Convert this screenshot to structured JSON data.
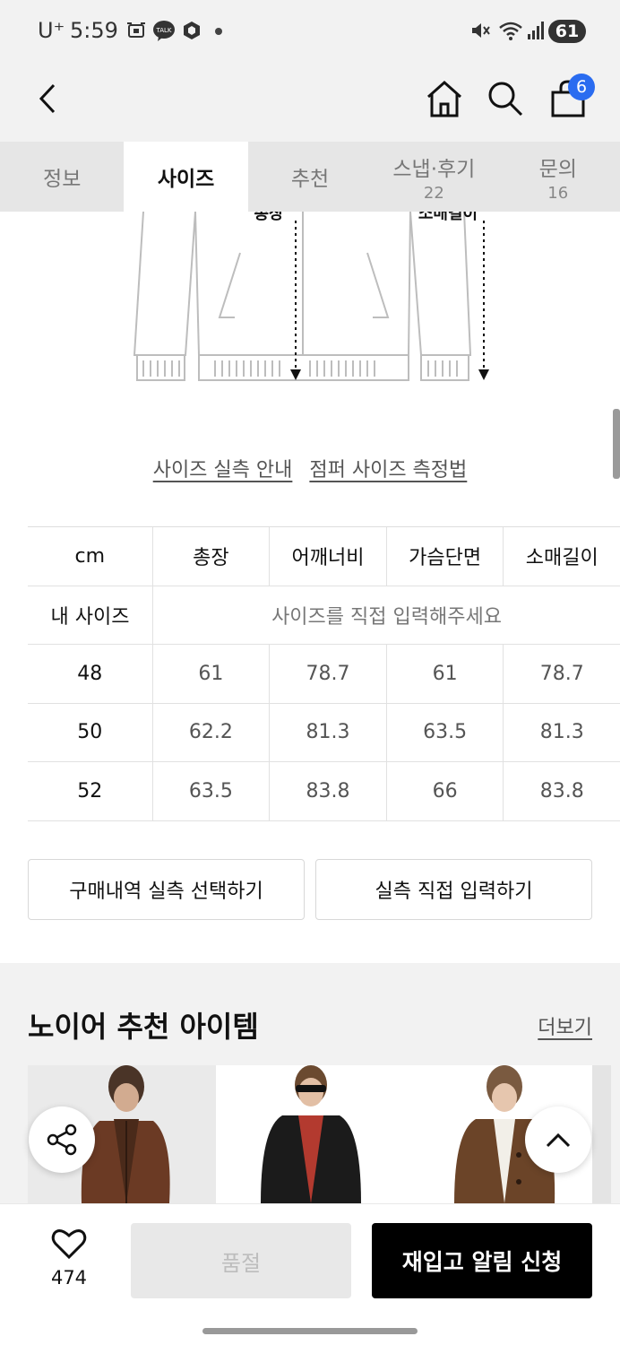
{
  "status_bar": {
    "carrier": "U⁺",
    "time": "5:59",
    "talk_label": "TALK",
    "battery": "61"
  },
  "header": {
    "cart_count": "6"
  },
  "tabs": [
    {
      "label": "정보",
      "count": ""
    },
    {
      "label": "사이즈",
      "count": ""
    },
    {
      "label": "추천",
      "count": ""
    },
    {
      "label": "스냅·후기",
      "count": "22"
    },
    {
      "label": "문의",
      "count": "16"
    }
  ],
  "illustration": {
    "label_left": "총장",
    "label_right": "소매길이"
  },
  "guide_links": {
    "actual_size": "사이즈 실측 안내",
    "how_to_measure": "점퍼 사이즈 측정법"
  },
  "size_table": {
    "headers": [
      "cm",
      "총장",
      "어깨너비",
      "가슴단면",
      "소매길이"
    ],
    "my_size_label": "내 사이즈",
    "my_size_prompt": "사이즈를 직접 입력해주세요",
    "rows": [
      {
        "size": "48",
        "values": [
          "61",
          "78.7",
          "61",
          "78.7"
        ]
      },
      {
        "size": "50",
        "values": [
          "62.2",
          "81.3",
          "63.5",
          "81.3"
        ]
      },
      {
        "size": "52",
        "values": [
          "63.5",
          "83.8",
          "66",
          "83.8"
        ]
      }
    ]
  },
  "actions": {
    "purchase_history": "구매내역 실측 선택하기",
    "direct_input": "실측 직접 입력하기"
  },
  "recommend": {
    "title": "노이어 추천 아이템",
    "more": "더보기"
  },
  "bottom_bar": {
    "like_count": "474",
    "soldout": "품절",
    "restock": "재입고 알림 신청"
  },
  "colors": {
    "accent_badge": "#2a6cf0",
    "primary_button": "#000000",
    "disabled_button": "#e8e8e8"
  }
}
